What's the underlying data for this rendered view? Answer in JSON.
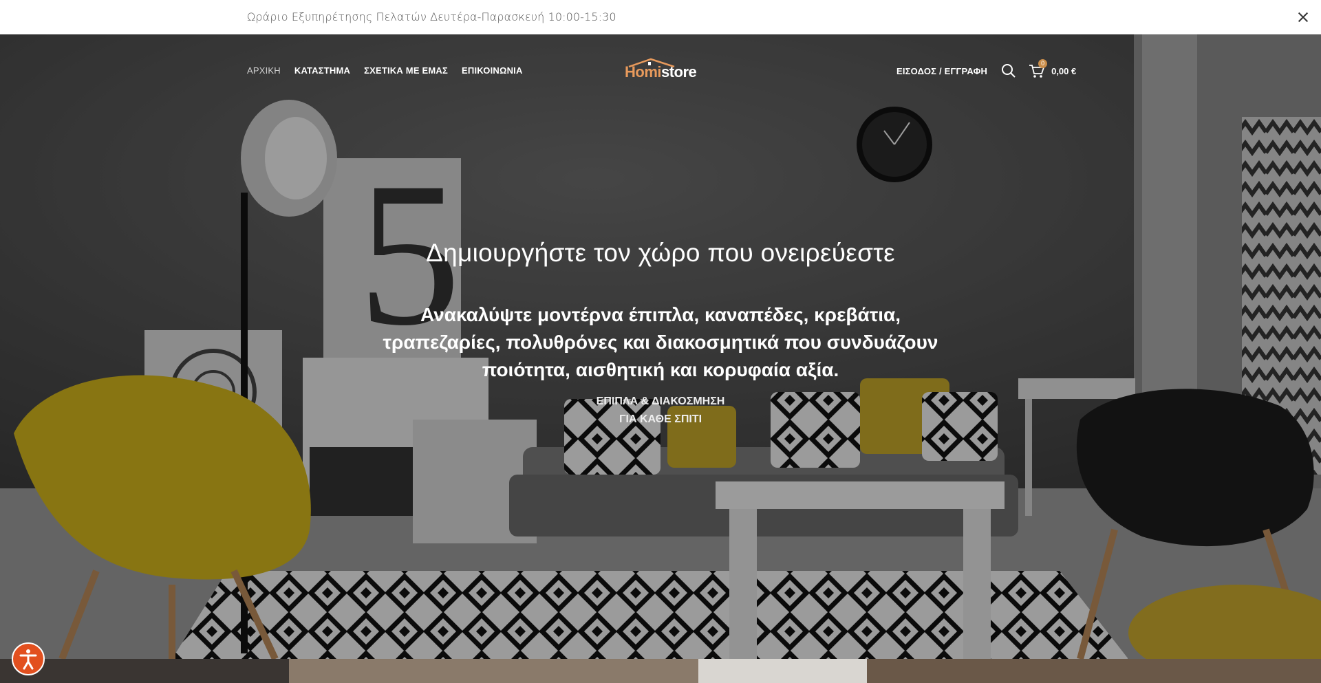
{
  "topbar": {
    "notice": "Ωράριο Εξυπηρέτησης Πελατών Δευτέρα-Παρασκευή 10:00-15:30"
  },
  "header": {
    "nav": [
      {
        "label": "ΑΡΧΙΚΗ",
        "active": true
      },
      {
        "label": "ΚΑΤΑΣΤΗΜΑ",
        "active": false
      },
      {
        "label": "ΣΧΕΤΙΚΑ ΜΕ ΕΜΑΣ",
        "active": false
      },
      {
        "label": "ΕΠΙΚΟΙΝΩΝΙΑ",
        "active": false
      }
    ],
    "logo": {
      "part1": "Homi",
      "part2": "store"
    },
    "login_label": "ΕΙΣΟΔΟΣ / ΕΓΓΡΑΦΗ",
    "cart_count": "0",
    "cart_total": "0,00 €"
  },
  "hero": {
    "title": "Δημιουργήστε τον χώρο που ονειρεύεστε",
    "subtitle": "Ανακαλύψτε μοντέρνα έπιπλα, καναπέδες, κρεβάτια, τραπεζαρίες, πολυθρόνες και διακοσμητικά που συνδυάζουν ποιότητα, αισθητική και κορυφαία αξία.",
    "tag_line1": "ΕΠΙΠΛΑ & ΔΙΑΚΟΣΜΗΣΗ",
    "tag_line2": "ΓΙΑ ΚΑΘΕ ΣΠΙΤΙ"
  },
  "icons": {
    "close": "close-icon",
    "search": "search-icon",
    "cart": "cart-icon",
    "accessibility": "accessibility-icon"
  },
  "colors": {
    "accent": "#e89a5c",
    "badge": "#c98d4a",
    "accessibility": "#e2501f"
  }
}
